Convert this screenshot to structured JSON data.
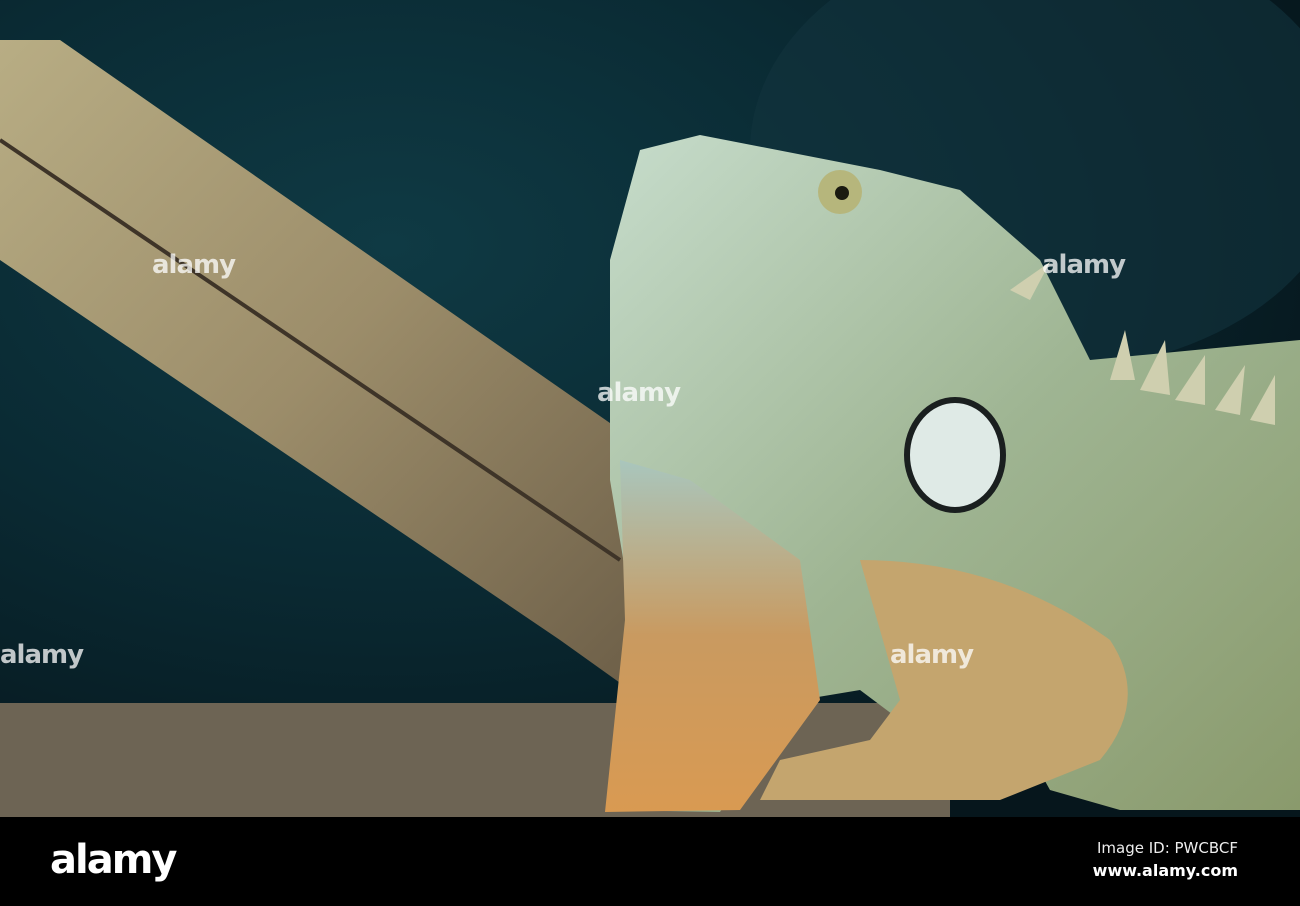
{
  "watermark": "alamy",
  "footer": {
    "logo": "alamy",
    "image_id": "Image ID: PWCBCF",
    "website": "www.alamy.com"
  },
  "colors": {
    "background": "#0a2a33",
    "wood": "#a89c78",
    "iguana": "#a9c4a8",
    "bar": "#000000"
  }
}
